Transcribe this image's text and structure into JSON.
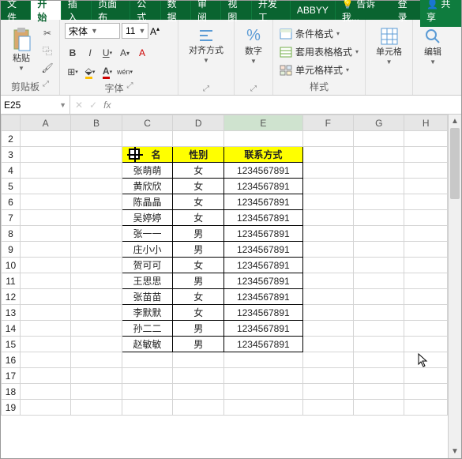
{
  "tabs": {
    "file": "文件",
    "active": "开始",
    "items": [
      "插入",
      "页面布",
      "公式",
      "数据",
      "审阅",
      "视图",
      "开发工",
      "ABBYY"
    ],
    "tell": "告诉我...",
    "login": "登录",
    "share": "共享"
  },
  "ribbon": {
    "clipboard": {
      "paste": "粘贴",
      "label": "剪贴板"
    },
    "font": {
      "name": "宋体",
      "size": "11",
      "label": "字体"
    },
    "align": {
      "label": "对齐方式"
    },
    "number": {
      "label": "数字"
    },
    "styles": {
      "cond": "条件格式",
      "tbl": "套用表格格式",
      "cell": "单元格样式",
      "label": "样式"
    },
    "cells": {
      "label": "单元格"
    },
    "editing": {
      "label": "编辑"
    }
  },
  "fbar": {
    "name": "E25",
    "fx": "fx",
    "value": ""
  },
  "cols": [
    "A",
    "B",
    "C",
    "D",
    "E",
    "F",
    "G",
    "H"
  ],
  "rowStart": 2,
  "rowEnd": 19,
  "headers": {
    "c": "名",
    "d": "性别",
    "e": "联系方式"
  },
  "headerCursorRow": 3,
  "data": [
    {
      "c": "张萌萌",
      "d": "女",
      "e": "1234567891"
    },
    {
      "c": "黄欣欣",
      "d": "女",
      "e": "1234567891"
    },
    {
      "c": "陈晶晶",
      "d": "女",
      "e": "1234567891"
    },
    {
      "c": "吴婷婷",
      "d": "女",
      "e": "1234567891"
    },
    {
      "c": "张一一",
      "d": "男",
      "e": "1234567891"
    },
    {
      "c": "庄小小",
      "d": "男",
      "e": "1234567891"
    },
    {
      "c": "贺可可",
      "d": "女",
      "e": "1234567891"
    },
    {
      "c": "王思思",
      "d": "男",
      "e": "1234567891"
    },
    {
      "c": "张苗苗",
      "d": "女",
      "e": "1234567891"
    },
    {
      "c": "李默默",
      "d": "女",
      "e": "1234567891"
    },
    {
      "c": "孙二二",
      "d": "男",
      "e": "1234567891"
    },
    {
      "c": "赵敏敏",
      "d": "男",
      "e": "1234567891"
    }
  ],
  "selectedCol": "E"
}
